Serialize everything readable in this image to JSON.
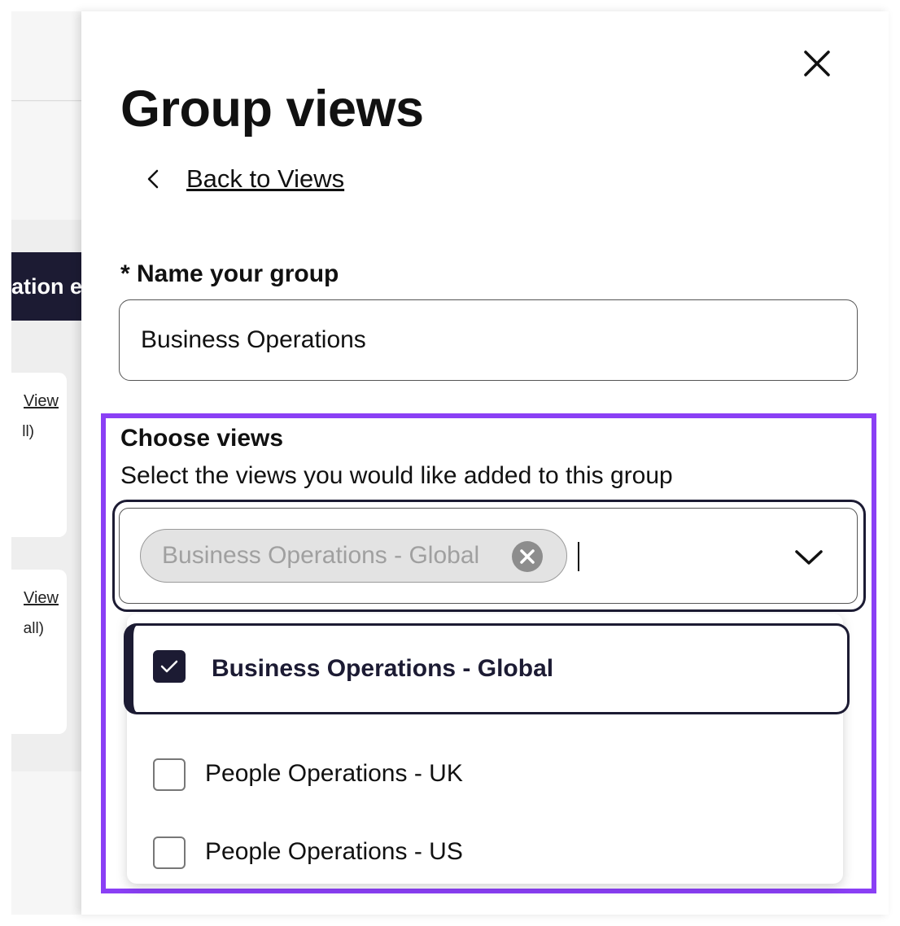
{
  "background": {
    "dark_bar_text": "ation e",
    "cards": [
      {
        "link": "View",
        "sub": "ll)"
      },
      {
        "link": "View",
        "sub": "all)"
      }
    ]
  },
  "drawer": {
    "title": "Group views",
    "back_link": "Back to Views",
    "close_icon": "close-icon"
  },
  "name_field": {
    "label": "* Name your group",
    "value": "Business Operations"
  },
  "choose_views": {
    "label": "Choose views",
    "help_text": "Select the views you would like added to this group",
    "selected_chips": [
      "Business Operations - Global"
    ],
    "options": [
      {
        "label": "Business Operations - Global",
        "checked": true
      },
      {
        "label": "People Operations - UK",
        "checked": false
      },
      {
        "label": "People Operations - US",
        "checked": false
      }
    ]
  },
  "colors": {
    "accent_focus": "#8a3ff5",
    "navy": "#1c1b33"
  }
}
